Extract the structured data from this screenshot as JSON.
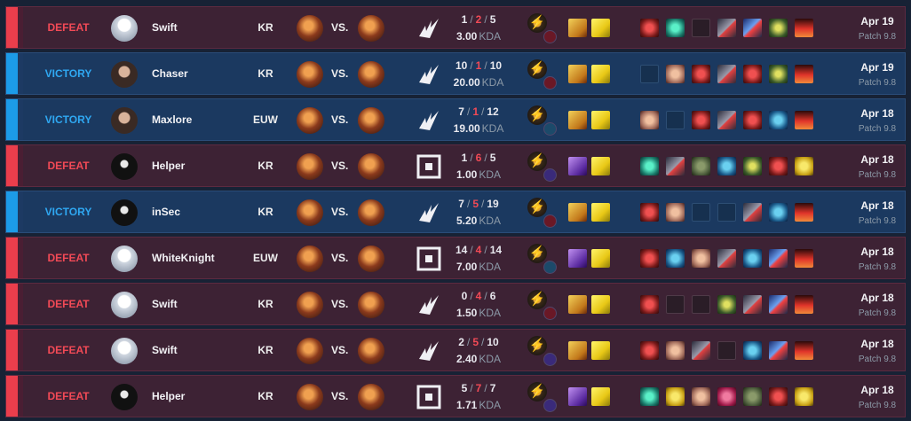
{
  "matches": [
    {
      "result": "DEFEAT",
      "outcome": "defeat",
      "player": "Swift",
      "avatar": "light",
      "region": "KR",
      "vs": "VS.",
      "lane": "mid",
      "kills": "1",
      "deaths": "2",
      "assists": "5",
      "kda": "3.00",
      "kda_label": "KDA",
      "secondary_tree": "domination",
      "summoners": [
        "ignite",
        "flash"
      ],
      "items": [
        "i-red",
        "i-teal",
        "empty",
        "i-blade",
        "i-sword",
        "i-green",
        "i-trinket"
      ],
      "date": "Apr 19",
      "patch": "Patch 9.8"
    },
    {
      "result": "VICTORY",
      "outcome": "victory",
      "player": "Chaser",
      "avatar": "photo",
      "region": "KR",
      "vs": "VS.",
      "lane": "mid",
      "kills": "10",
      "deaths": "1",
      "assists": "10",
      "kda": "20.00",
      "kda_label": "KDA",
      "secondary_tree": "domination",
      "summoners": [
        "ignite",
        "flash"
      ],
      "items": [
        "empty",
        "i-wing",
        "i-red",
        "i-blade",
        "i-red",
        "i-green",
        "i-trinket"
      ],
      "date": "Apr 19",
      "patch": "Patch 9.8"
    },
    {
      "result": "VICTORY",
      "outcome": "victory",
      "player": "Maxlore",
      "avatar": "photo",
      "region": "EUW",
      "vs": "VS.",
      "lane": "mid",
      "kills": "7",
      "deaths": "1",
      "assists": "12",
      "kda": "19.00",
      "kda_label": "KDA",
      "secondary_tree": "inspiration",
      "summoners": [
        "ignite",
        "flash"
      ],
      "items": [
        "i-wing",
        "empty",
        "i-red",
        "i-blade",
        "i-red",
        "i-blue",
        "i-trinket"
      ],
      "date": "Apr 18",
      "patch": "Patch 9.8"
    },
    {
      "result": "DEFEAT",
      "outcome": "defeat",
      "player": "Helper",
      "avatar": "dark",
      "region": "KR",
      "vs": "VS.",
      "lane": "jungle",
      "kills": "1",
      "deaths": "6",
      "assists": "5",
      "kda": "1.00",
      "kda_label": "KDA",
      "secondary_tree": "sorcery",
      "summoners": [
        "exhaust",
        "flash"
      ],
      "items": [
        "i-teal",
        "i-blade",
        "i-rock",
        "i-blue",
        "i-green",
        "i-red",
        "i-gold"
      ],
      "date": "Apr 18",
      "patch": "Patch 9.8"
    },
    {
      "result": "VICTORY",
      "outcome": "victory",
      "player": "inSec",
      "avatar": "dark",
      "region": "KR",
      "vs": "VS.",
      "lane": "mid",
      "kills": "7",
      "deaths": "5",
      "assists": "19",
      "kda": "5.20",
      "kda_label": "KDA",
      "secondary_tree": "domination",
      "summoners": [
        "ignite",
        "flash"
      ],
      "items": [
        "i-red",
        "i-wing",
        "empty",
        "empty",
        "i-blade",
        "i-blue",
        "i-trinket"
      ],
      "date": "Apr 18",
      "patch": "Patch 9.8"
    },
    {
      "result": "DEFEAT",
      "outcome": "defeat",
      "player": "WhiteKnight",
      "avatar": "light",
      "region": "EUW",
      "vs": "VS.",
      "lane": "jungle",
      "kills": "14",
      "deaths": "4",
      "assists": "14",
      "kda": "7.00",
      "kda_label": "KDA",
      "secondary_tree": "inspiration",
      "summoners": [
        "exhaust",
        "flash"
      ],
      "items": [
        "i-red",
        "i-blue",
        "i-wing",
        "i-blade",
        "i-blue",
        "i-sword",
        "i-trinket"
      ],
      "date": "Apr 18",
      "patch": "Patch 9.8"
    },
    {
      "result": "DEFEAT",
      "outcome": "defeat",
      "player": "Swift",
      "avatar": "light",
      "region": "KR",
      "vs": "VS.",
      "lane": "mid",
      "kills": "0",
      "deaths": "4",
      "assists": "6",
      "kda": "1.50",
      "kda_label": "KDA",
      "secondary_tree": "domination",
      "summoners": [
        "ignite",
        "flash"
      ],
      "items": [
        "i-red",
        "empty",
        "empty",
        "i-green",
        "i-blade",
        "i-sword",
        "i-trinket"
      ],
      "date": "Apr 18",
      "patch": "Patch 9.8"
    },
    {
      "result": "DEFEAT",
      "outcome": "defeat",
      "player": "Swift",
      "avatar": "light",
      "region": "KR",
      "vs": "VS.",
      "lane": "mid",
      "kills": "2",
      "deaths": "5",
      "assists": "10",
      "kda": "2.40",
      "kda_label": "KDA",
      "secondary_tree": "sorcery",
      "summoners": [
        "ignite",
        "flash"
      ],
      "items": [
        "i-red",
        "i-wing",
        "i-blade",
        "empty",
        "i-blue",
        "i-sword",
        "i-trinket"
      ],
      "date": "Apr 18",
      "patch": "Patch 9.8"
    },
    {
      "result": "DEFEAT",
      "outcome": "defeat",
      "player": "Helper",
      "avatar": "dark",
      "region": "KR",
      "vs": "VS.",
      "lane": "jungle",
      "kills": "5",
      "deaths": "7",
      "assists": "7",
      "kda": "1.71",
      "kda_label": "KDA",
      "secondary_tree": "sorcery",
      "summoners": [
        "smite",
        "exhaust",
        "flash"
      ],
      "items": [
        "i-teal",
        "i-gold",
        "i-wing",
        "i-pink",
        "i-rock",
        "i-red",
        "i-gold"
      ],
      "date": "Apr 18",
      "patch": "Patch 9.8"
    }
  ]
}
